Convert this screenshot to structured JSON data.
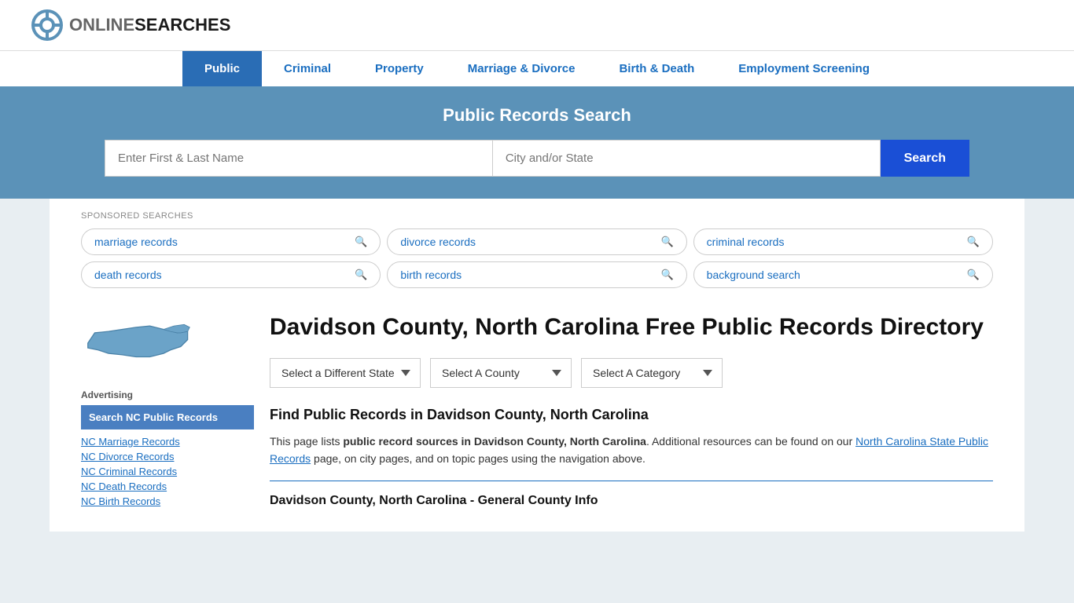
{
  "logo": {
    "online": "ONLINE",
    "searches": "SEARCHES",
    "alt": "OnlineSearches Logo"
  },
  "nav": {
    "items": [
      {
        "label": "Public",
        "active": true
      },
      {
        "label": "Criminal",
        "active": false
      },
      {
        "label": "Property",
        "active": false
      },
      {
        "label": "Marriage & Divorce",
        "active": false
      },
      {
        "label": "Birth & Death",
        "active": false
      },
      {
        "label": "Employment Screening",
        "active": false
      }
    ]
  },
  "hero": {
    "title": "Public Records Search",
    "name_placeholder": "Enter First & Last Name",
    "location_placeholder": "City and/or State",
    "search_button": "Search"
  },
  "sponsored": {
    "label": "SPONSORED SEARCHES",
    "items": [
      {
        "text": "marriage records"
      },
      {
        "text": "divorce records"
      },
      {
        "text": "criminal records"
      },
      {
        "text": "death records"
      },
      {
        "text": "birth records"
      },
      {
        "text": "background search"
      }
    ]
  },
  "sidebar": {
    "ad_label": "Advertising",
    "ad_item": "Search NC Public Records",
    "links": [
      "NC Marriage Records",
      "NC Divorce Records",
      "NC Criminal Records",
      "NC Death Records",
      "NC Birth Records"
    ]
  },
  "main": {
    "title": "Davidson County, North Carolina Free Public Records Directory",
    "dropdowns": {
      "state": "Select a Different State",
      "county": "Select A County",
      "category": "Select A Category"
    },
    "find_title": "Find Public Records in Davidson County, North Carolina",
    "find_text_1": "This page lists ",
    "find_text_bold": "public record sources in Davidson County, North Carolina",
    "find_text_2": ". Additional resources can be found on our ",
    "find_link": "North Carolina State Public Records",
    "find_text_3": " page, on city pages, and on topic pages using the navigation above.",
    "general_info_title": "Davidson County, North Carolina - General County Info"
  }
}
